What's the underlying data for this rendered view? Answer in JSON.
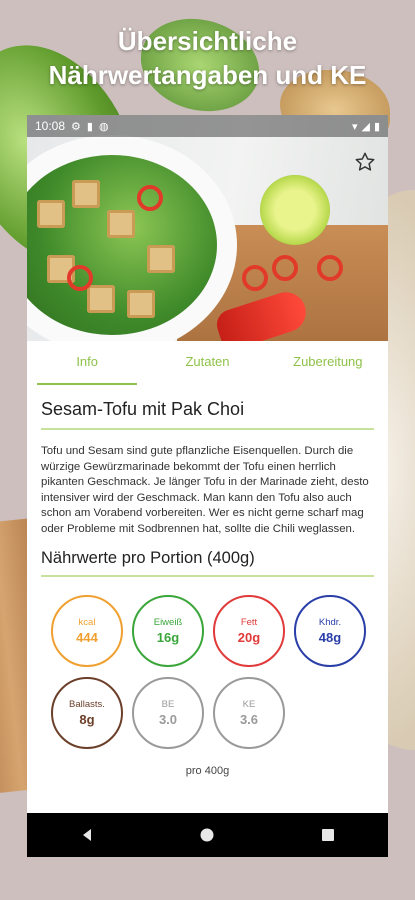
{
  "promo": {
    "headline_line1": "Übersichtliche",
    "headline_line2": "Nährwertangaben und KE"
  },
  "status_bar": {
    "time": "10:08"
  },
  "tabs": [
    {
      "label": "Info",
      "active": true
    },
    {
      "label": "Zutaten",
      "active": false
    },
    {
      "label": "Zubereitung",
      "active": false
    }
  ],
  "recipe": {
    "title": "Sesam-Tofu mit Pak Choi",
    "description": "Tofu und Sesam sind gute pflanzliche Eisenquellen. Durch die würzige Gewürzmarinade bekommt der Tofu einen herrlich pikanten Geschmack. Je länger Tofu in der Marinade zieht, desto intensiver wird der Geschmack. Man kann den Tofu also auch schon am Vorabend vorbereiten. Wer es nicht gerne scharf mag oder Probleme mit Sodbrennen hat, sollte die Chili weglassen."
  },
  "nutrition": {
    "heading": "Nährwerte pro Portion (400g)",
    "items": [
      {
        "label": "kcal",
        "value": "444",
        "color": "#f0a030"
      },
      {
        "label": "Eiweiß",
        "value": "16g",
        "color": "#3aa63a"
      },
      {
        "label": "Fett",
        "value": "20g",
        "color": "#e03a3a"
      },
      {
        "label": "Khdr.",
        "value": "48g",
        "color": "#2a3ea8"
      },
      {
        "label": "Ballasts.",
        "value": "8g",
        "color": "#6b3f2a"
      },
      {
        "label": "BE",
        "value": "3.0",
        "color": "#9a9a9a"
      },
      {
        "label": "KE",
        "value": "3.6",
        "color": "#9a9a9a"
      }
    ],
    "per_label": "pro 400g"
  }
}
